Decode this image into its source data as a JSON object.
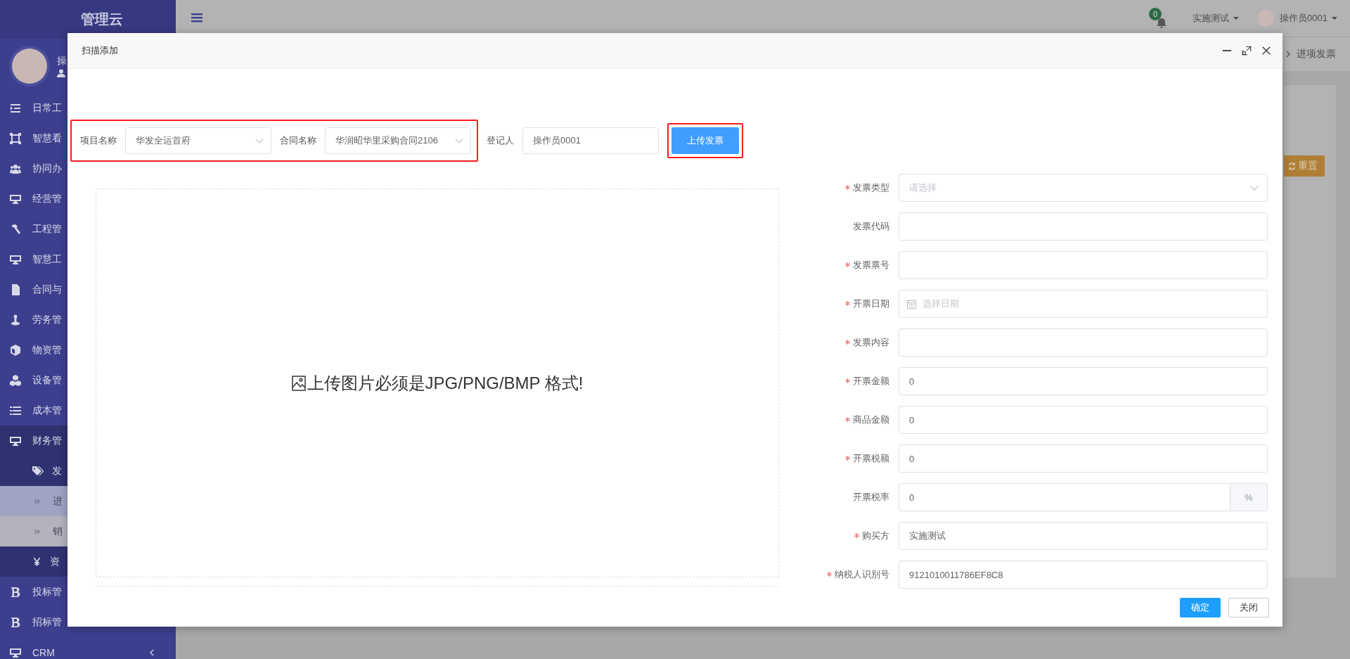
{
  "sidebar": {
    "logo": "管理云",
    "user_name": "操",
    "items": [
      {
        "label": "日常工",
        "selected": false,
        "hover": false
      },
      {
        "label": "智慧看",
        "selected": false,
        "hover": false
      },
      {
        "label": "协同办",
        "selected": false,
        "hover": false
      },
      {
        "label": "经营管",
        "selected": false,
        "hover": false
      },
      {
        "label": "工程管",
        "selected": false,
        "hover": false
      },
      {
        "label": "智慧工",
        "selected": false,
        "hover": false
      },
      {
        "label": "合同与",
        "selected": false,
        "hover": false
      },
      {
        "label": "劳务管",
        "selected": false,
        "hover": false
      },
      {
        "label": "物资管",
        "selected": false,
        "hover": false
      },
      {
        "label": "设备管",
        "selected": false,
        "hover": false
      },
      {
        "label": "成本管",
        "selected": false,
        "hover": false
      },
      {
        "label": "财务管",
        "selected": false,
        "hover": false,
        "expanded": true,
        "children": [
          {
            "label": "发",
            "selected": false,
            "hover": false,
            "expanded": true,
            "children": [
              {
                "label": "进",
                "selected": true,
                "hover": false
              },
              {
                "label": "销",
                "selected": false,
                "hover": true
              }
            ]
          },
          {
            "label": "资",
            "selected": false,
            "hover": false
          }
        ]
      },
      {
        "label": "投标管",
        "selected": false,
        "hover": false
      },
      {
        "label": "招标管",
        "selected": false,
        "hover": false
      },
      {
        "label": "CRM",
        "selected": false,
        "hover": false,
        "expandable": true
      }
    ]
  },
  "topbar": {
    "notification_count": "0",
    "organization": "实施测试",
    "user": "操作员0001"
  },
  "breadcrumb": {
    "current": "进项发票"
  },
  "background_page": {
    "reset_button": "重置"
  },
  "dialog": {
    "title": "扫描添加",
    "top_row": {
      "highlighted": true,
      "project": {
        "label": "项目名称",
        "value": "华发全运首府"
      },
      "contract": {
        "label": "合同名称",
        "value": "华润昭华里采购合同2106"
      }
    },
    "registrar": {
      "label": "登记人",
      "value": "操作员0001"
    },
    "upload_button": {
      "label": "上传发票",
      "highlighted": true
    },
    "upload_area": {
      "hint": "上传图片必须是JPG/PNG/BMP 格式!"
    },
    "form": [
      {
        "label": "发票类型",
        "required": true,
        "kind": "select",
        "placeholder": "请选择"
      },
      {
        "label": "发票代码",
        "required": false,
        "kind": "text"
      },
      {
        "label": "发票票号",
        "required": true,
        "kind": "text"
      },
      {
        "label": "开票日期",
        "required": true,
        "kind": "date",
        "placeholder": "选择日期"
      },
      {
        "label": "发票内容",
        "required": true,
        "kind": "text"
      },
      {
        "label": "开票金额",
        "required": true,
        "kind": "text",
        "value": "0"
      },
      {
        "label": "商品金额",
        "required": true,
        "kind": "text",
        "value": "0"
      },
      {
        "label": "开票税额",
        "required": true,
        "kind": "text",
        "value": "0"
      },
      {
        "label": "开票税率",
        "required": false,
        "kind": "percent",
        "value": "0",
        "suffix": "%"
      },
      {
        "label": "购买方",
        "required": true,
        "kind": "text",
        "value": "实施测试"
      },
      {
        "label": "纳税人识别号",
        "required": true,
        "kind": "text",
        "value": "9121010011786EF8C8"
      }
    ],
    "buttons": [
      {
        "label": "确定",
        "kind": "primary"
      },
      {
        "label": "关闭",
        "kind": "default"
      }
    ]
  }
}
